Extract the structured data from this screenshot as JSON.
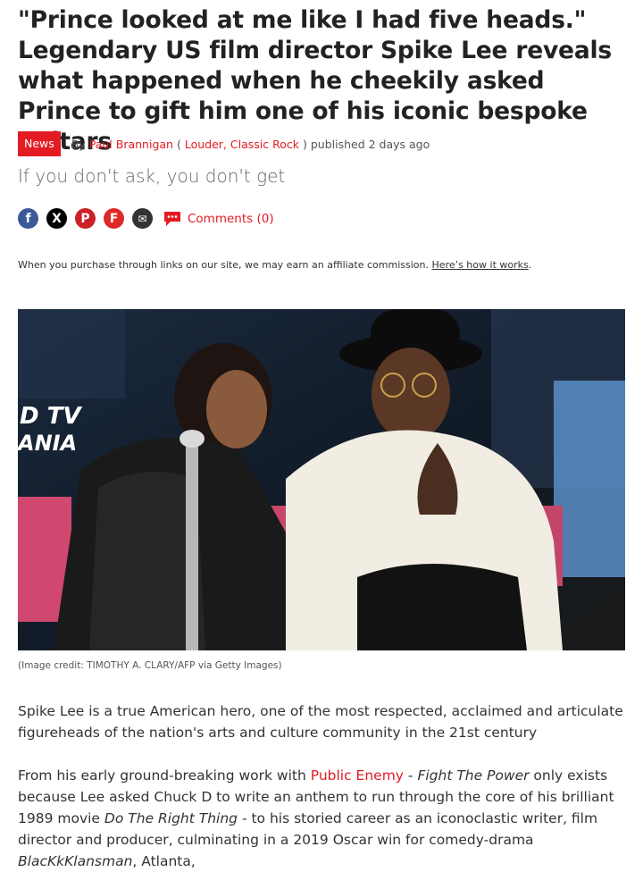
{
  "article": {
    "title": "\"Prince looked at me like I had five heads.\" Legendary US film director Spike Lee reveals what happened when he cheekily asked Prince to gift him one of his iconic bespoke guitars",
    "category": "News",
    "by": "By",
    "author": "Paul Brannigan",
    "publications_open": "(",
    "publication_1": "Louder",
    "publication_sep": ",",
    "publication_2": "Classic Rock",
    "publications_close": ")",
    "published": "published 2 days ago",
    "strapline": "If you don't ask, you don't get",
    "comments_label": "Comments (0)",
    "affiliate_text": "When you purchase through links on our site, we may earn an affiliate commission.",
    "affiliate_link": "Here’s how it works",
    "image_credit": "(Image credit: TIMOTHY A. CLARY/AFP via Getty Images)",
    "image_overlay_text": "TV ANIA",
    "para1": "Spike Lee is a true American hero, one of the most respected, acclaimed and articulate figureheads of the nation's arts and culture community in the 21st century",
    "para2": {
      "part1": "From his early ground-breaking work with",
      "link": "Public Enemy",
      "part2": " - ",
      "italic1": "Fight The Power",
      "part3": " only exists because Lee asked Chuck D to write an anthem to run through the core of his brilliant 1989 movie ",
      "italic2": "Do The Right Thing",
      "part4": " - to his storied career as an iconoclastic writer, film director and producer, culminating in a 2019 Oscar win for comedy-drama ",
      "italic3": "BlacKkKlansman",
      "part5": ", Atlanta,"
    }
  },
  "share_icons": [
    {
      "name": "facebook-icon",
      "glyph": "f",
      "color": "#3b5998"
    },
    {
      "name": "x-twitter-icon",
      "glyph": "X",
      "color": "#000000"
    },
    {
      "name": "pinterest-icon",
      "glyph": "P",
      "color": "#cb2027"
    },
    {
      "name": "flipboard-icon",
      "glyph": "F",
      "color": "#e12828"
    },
    {
      "name": "email-icon",
      "glyph": "✉",
      "color": "#333333"
    }
  ],
  "colors": {
    "accent": "#e31b23",
    "text": "#333333"
  }
}
